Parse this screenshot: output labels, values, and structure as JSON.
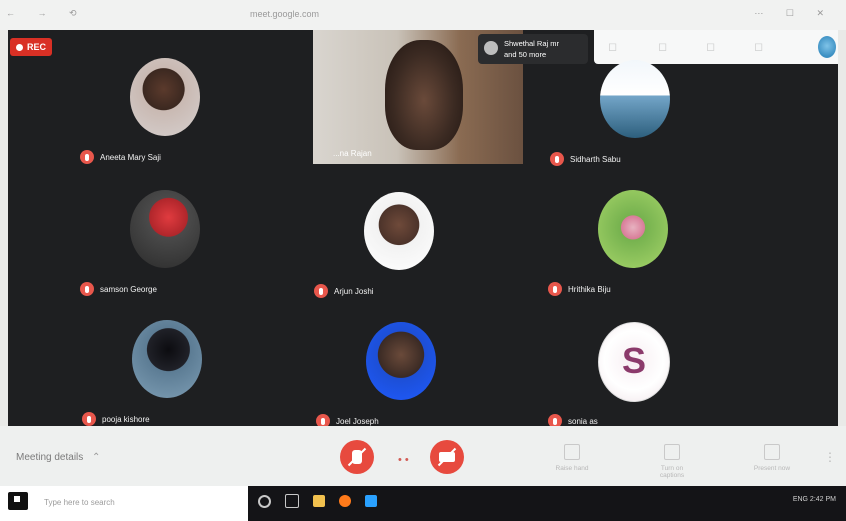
{
  "browser": {
    "url": "meet.google.com"
  },
  "stage": {
    "recording_label": "REC",
    "spotlight": {
      "name": "...na Rajan"
    },
    "others_pill": {
      "line1": "Shwethal Raj mr",
      "line2": "and 50 more"
    }
  },
  "participants": [
    {
      "name": "Aneeta Mary Saji",
      "avatar_style": "a1"
    },
    {
      "name": "Sidharth Sabu",
      "avatar_style": "a2"
    },
    {
      "name": "samson George",
      "avatar_style": "a3"
    },
    {
      "name": "Arjun Joshi",
      "avatar_style": "a4"
    },
    {
      "name": "Hrithika Biju",
      "avatar_style": "a5"
    },
    {
      "name": "pooja kishore",
      "avatar_style": "a6"
    },
    {
      "name": "Joel Joseph",
      "avatar_style": "a7"
    },
    {
      "name": "sonia as",
      "avatar_style": "a8",
      "letter": "S"
    }
  ],
  "bottom_bar": {
    "meeting_details_label": "Meeting details",
    "meeting_details_caret": "⌃",
    "mid_indicator": "• •",
    "right_controls": [
      {
        "label": "Raise hand"
      },
      {
        "label": "Turn on captions"
      },
      {
        "label": "Present now"
      }
    ],
    "kebab": "⋮"
  },
  "desktop": {
    "left_text": "Type here to search"
  },
  "taskbar": {
    "right_text": "ENG  2:42 PM"
  },
  "colors": {
    "stage_bg": "#1e1f21",
    "danger": "#e74a3e",
    "mic_badge": "#e8574c"
  }
}
